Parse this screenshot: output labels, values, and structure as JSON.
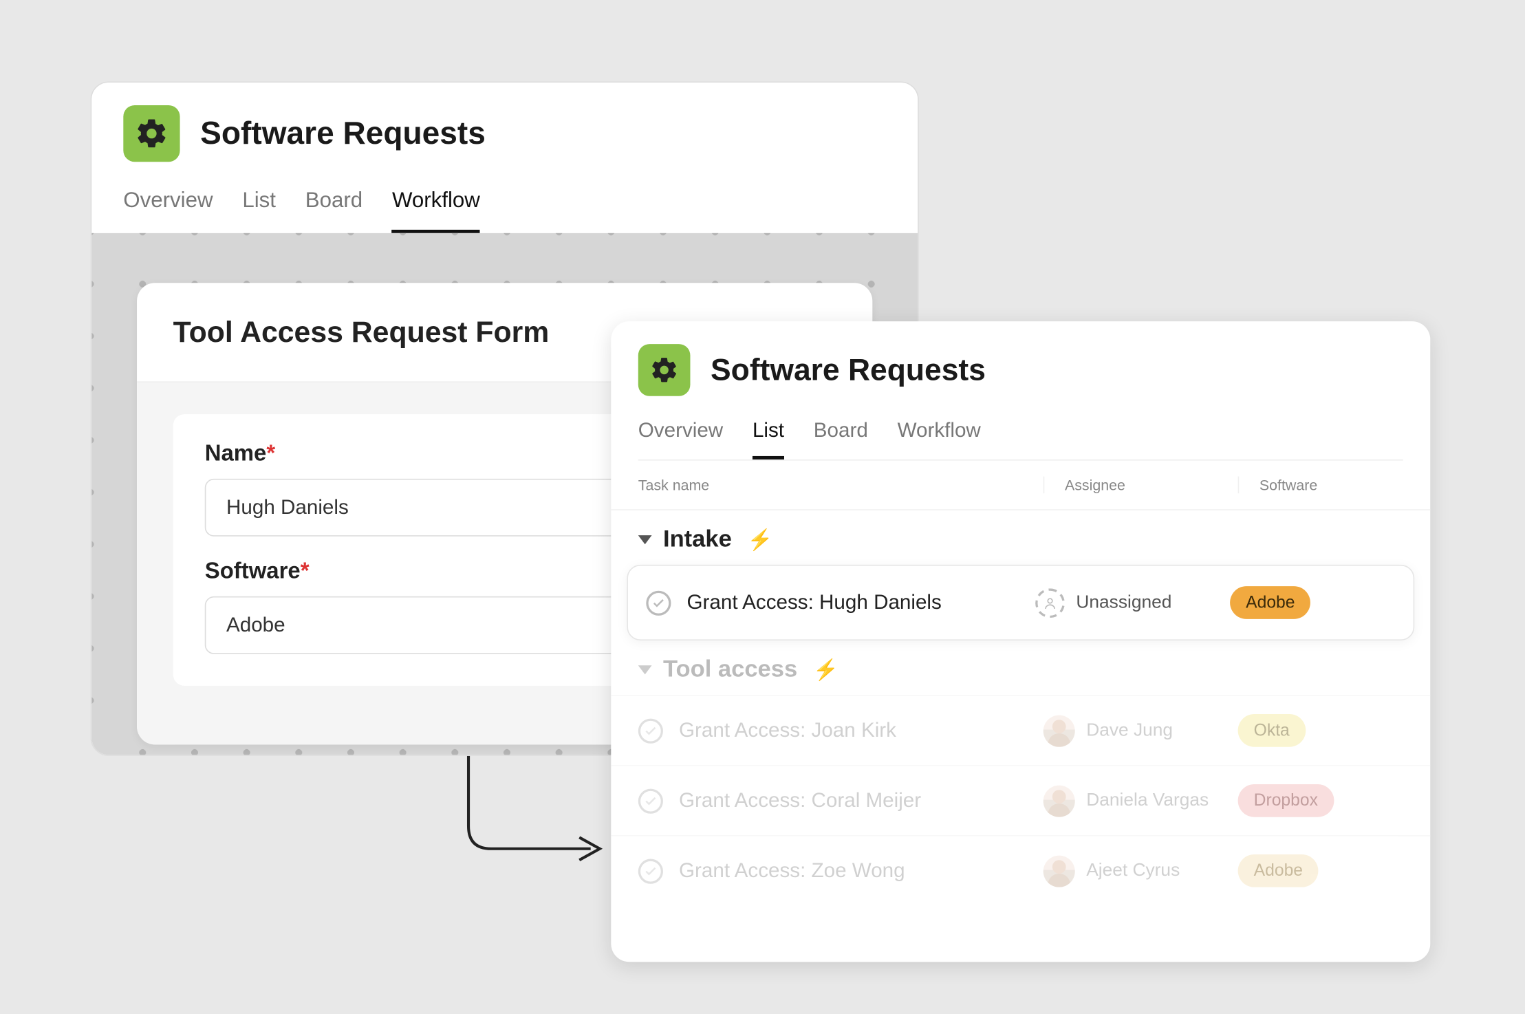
{
  "project": {
    "title": "Software Requests",
    "icon": "gear-icon"
  },
  "tabs_back": [
    "Overview",
    "List",
    "Board",
    "Workflow"
  ],
  "tabs_back_active": "Workflow",
  "form": {
    "title": "Tool Access Request Form",
    "fields": {
      "name": {
        "label": "Name",
        "required": "*",
        "value": "Hugh Daniels"
      },
      "software": {
        "label": "Software",
        "required": "*",
        "value": "Adobe"
      }
    }
  },
  "tabs_front": [
    "Overview",
    "List",
    "Board",
    "Workflow"
  ],
  "tabs_front_active": "List",
  "table": {
    "columns": {
      "task": "Task name",
      "assignee": "Assignee",
      "software": "Software"
    },
    "sections": {
      "intake": {
        "label": "Intake"
      },
      "toolaccess": {
        "label": "Tool access"
      }
    },
    "intake_row": {
      "task": "Grant Access: Hugh Daniels",
      "assignee": "Unassigned",
      "software": "Adobe"
    },
    "rows": [
      {
        "task": "Grant Access: Joan Kirk",
        "assignee": "Dave Jung",
        "software": "Okta",
        "pill": "pill-okta"
      },
      {
        "task": "Grant Access: Coral Meijer",
        "assignee": "Daniela Vargas",
        "software": "Dropbox",
        "pill": "pill-dropbox"
      },
      {
        "task": "Grant Access: Zoe Wong",
        "assignee": "Ajeet Cyrus",
        "software": "Adobe",
        "pill": "pill-adobe2"
      }
    ]
  }
}
